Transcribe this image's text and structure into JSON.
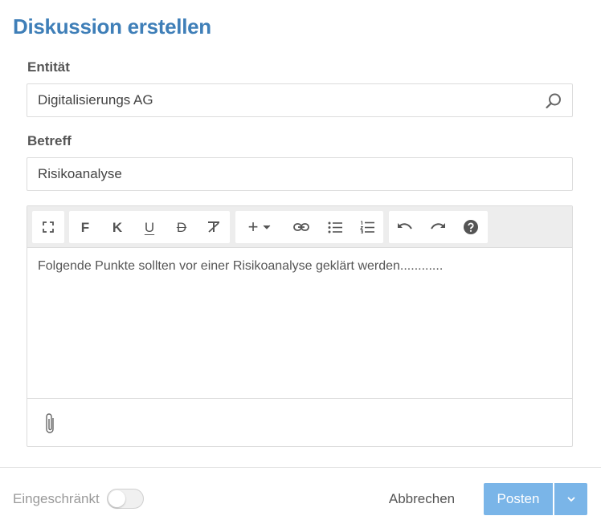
{
  "dialog": {
    "title": "Diskussion erstellen"
  },
  "form": {
    "entity_label": "Entität",
    "entity_value": "Digitalisierungs AG",
    "subject_label": "Betreff",
    "subject_value": "Risikoanalyse"
  },
  "editor": {
    "toolbar": {
      "fullscreen_icon": "fullscreen-icon",
      "bold_label": "F",
      "italic_label": "K",
      "underline_label": "U",
      "strikethrough_label": "D",
      "clear_format_icon": "clear-format-icon",
      "insert_label": "+",
      "link_icon": "link-icon",
      "bullet_list_icon": "bullet-list-icon",
      "numbered_list_icon": "numbered-list-icon",
      "undo_icon": "undo-icon",
      "redo_icon": "redo-icon",
      "help_icon": "help-icon"
    },
    "content": "Folgende Punkte sollten vor einer Risikoanalyse geklärt werden............",
    "attach_icon": "paperclip-icon"
  },
  "footer": {
    "restricted_label": "Eingeschränkt",
    "restricted_on": false,
    "cancel_label": "Abbrechen",
    "post_label": "Posten"
  },
  "colors": {
    "title": "#3f7fb8",
    "primary_button": "#7ab5e8",
    "toolbar_bg": "#ededed"
  }
}
